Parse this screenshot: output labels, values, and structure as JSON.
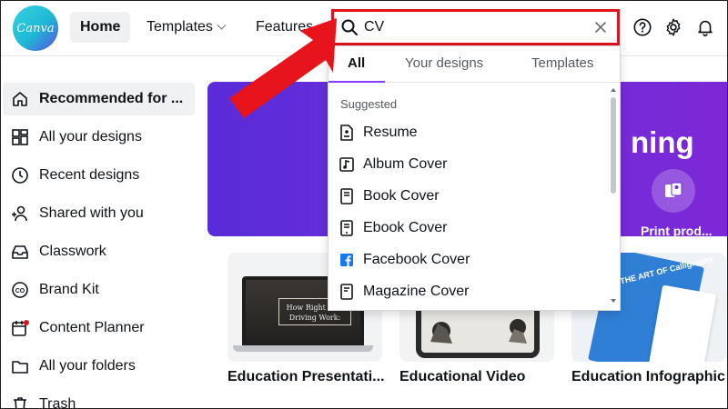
{
  "header": {
    "logo_text": "Canva",
    "nav": {
      "home": "Home",
      "templates": "Templates",
      "features": "Features"
    }
  },
  "search": {
    "value": "CV",
    "tabs": [
      "All",
      "Your designs",
      "Templates"
    ],
    "active_tab": "All",
    "section_title": "Suggested",
    "suggestions": [
      {
        "label": "Resume",
        "icon": "document-icon"
      },
      {
        "label": "Album Cover",
        "icon": "music-note-icon"
      },
      {
        "label": "Book Cover",
        "icon": "book-icon"
      },
      {
        "label": "Ebook Cover",
        "icon": "ebook-icon"
      },
      {
        "label": "Facebook Cover",
        "icon": "facebook-icon"
      },
      {
        "label": "Magazine Cover",
        "icon": "magazine-icon"
      }
    ]
  },
  "sidebar": {
    "items": [
      {
        "label": "Recommended for ...",
        "icon": "home-icon"
      },
      {
        "label": "All your designs",
        "icon": "grid-icon"
      },
      {
        "label": "Recent designs",
        "icon": "clock-icon"
      },
      {
        "label": "Shared with you",
        "icon": "people-icon"
      },
      {
        "label": "Classwork",
        "icon": "inbox-icon"
      },
      {
        "label": "Brand Kit",
        "icon": "brand-kit-icon"
      },
      {
        "label": "Content Planner",
        "icon": "calendar-icon"
      },
      {
        "label": "All your folders",
        "icon": "folder-icon"
      },
      {
        "label": "Trash",
        "icon": "trash-icon"
      }
    ]
  },
  "main": {
    "banner_text": "ning",
    "print_label": "Print prod...",
    "cards": [
      {
        "label": "Education Presentati...",
        "preview_text": "How Right Han\nDriving Work:"
      },
      {
        "label": "Educational Video"
      },
      {
        "label": "Education Infographic",
        "preview_text": "THE ART OF Calligraphy"
      }
    ]
  },
  "colors": {
    "accent": "#8b3dff",
    "highlight_border": "#e0121b",
    "arrow": "#e8141b",
    "banner": "#6b2fdc",
    "facebook": "#1877f2"
  }
}
